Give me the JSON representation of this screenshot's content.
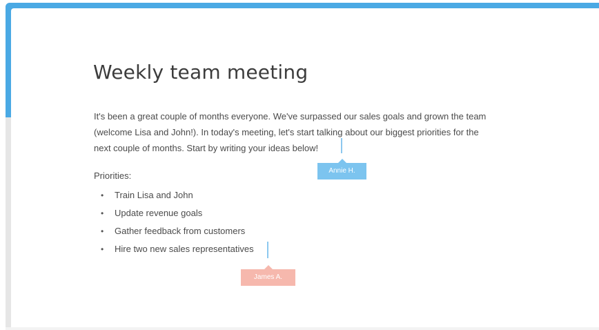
{
  "document": {
    "title": "Weekly team meeting",
    "intro_lines": [
      "It's been a great couple of months everyone. We've surpassed our sales goals and grown the team",
      "(welcome Lisa and John!). In today's meeting, let's start talking about our biggest priorities for the",
      "next couple of months. Start by writing your ideas below!"
    ],
    "priorities_label": "Priorities:",
    "bullet_glyph": "•",
    "priorities": [
      "Train Lisa and John",
      "Update revenue goals",
      "Gather feedback from customers",
      "Hire two new sales representatives"
    ]
  },
  "collaborators": [
    {
      "name": "Annie H.",
      "color": "#7cc4ef"
    },
    {
      "name": "James A.",
      "color": "#f6b8ad"
    }
  ],
  "colors": {
    "frame_accent": "#4aa9e4",
    "text": "#4a4a4a",
    "title": "#3c3c3c",
    "cursor": "#8cc8ef"
  }
}
